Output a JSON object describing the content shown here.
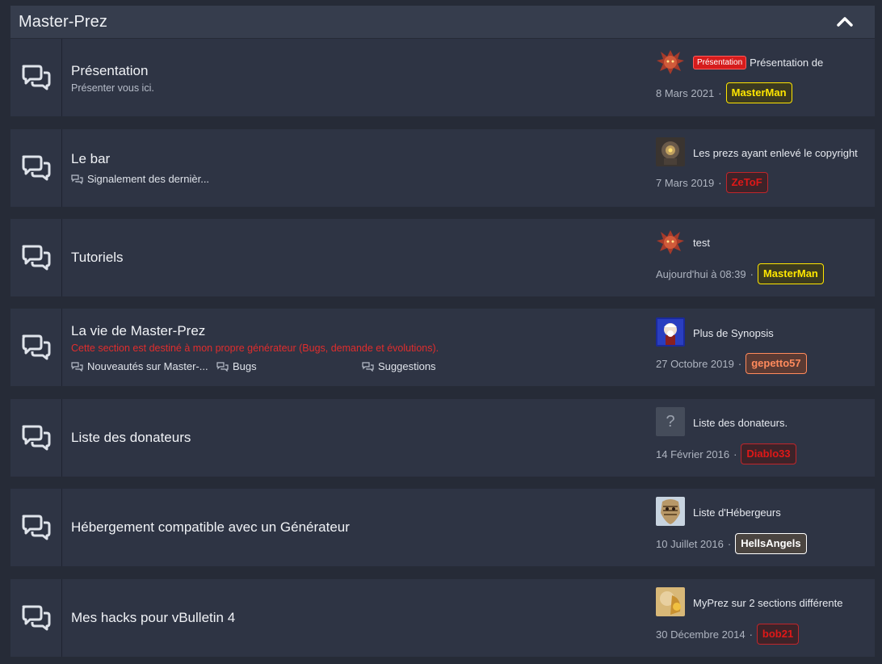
{
  "category": {
    "title": "Master-Prez"
  },
  "forums": [
    {
      "title": "Présentation",
      "description": "Présenter vous ici.",
      "last_post": {
        "prefix": "Présentation",
        "title": "Présentation de",
        "date": "8 Mars 2021",
        "user": "MasterMan"
      }
    },
    {
      "title": "Le bar",
      "subforums": [
        "Signalement des dernièr..."
      ],
      "last_post": {
        "title": "Les prezs ayant enlevé le copyright",
        "date": "7 Mars 2019",
        "user": "ZeToF"
      }
    },
    {
      "title": "Tutoriels",
      "last_post": {
        "title": "test",
        "date": "Aujourd'hui à 08:39",
        "user": "MasterMan"
      }
    },
    {
      "title": "La vie de Master-Prez",
      "description": "Cette section est destiné à mon propre générateur (Bugs, demande et évolutions).",
      "subforums": [
        "Nouveautés sur Master-...",
        "Bugs",
        "Suggestions"
      ],
      "last_post": {
        "title": "Plus de Synopsis",
        "date": "27 Octobre 2019",
        "user": "gepetto57"
      }
    },
    {
      "title": "Liste des donateurs",
      "last_post": {
        "title": "Liste des donateurs.",
        "date": "14 Février 2016",
        "user": "Diablo33",
        "avatar_placeholder": "?"
      }
    },
    {
      "title": "Hébergement compatible avec un Générateur",
      "last_post": {
        "title": "Liste d'Hébergeurs",
        "date": "10 Juillet 2016",
        "user": "HellsAngels"
      }
    },
    {
      "title": "Mes hacks pour vBulletin 4",
      "last_post": {
        "title": "MyPrez sur 2 sections différente",
        "date": "30 Décembre 2014",
        "user": "bob21"
      }
    }
  ],
  "meta_separator": "·",
  "colors": {
    "background": "#262b37",
    "row": "#2e3444",
    "header": "#363d4d",
    "red_text": "#e02d2d",
    "yellow_user": "#ffe600",
    "red_user": "#e01818",
    "orange_user": "#ff8a5c"
  },
  "icons": {
    "forum": "speech-bubbles-icon",
    "subforum": "small-speech-bubbles-icon",
    "collapse": "chevron-up-icon"
  }
}
